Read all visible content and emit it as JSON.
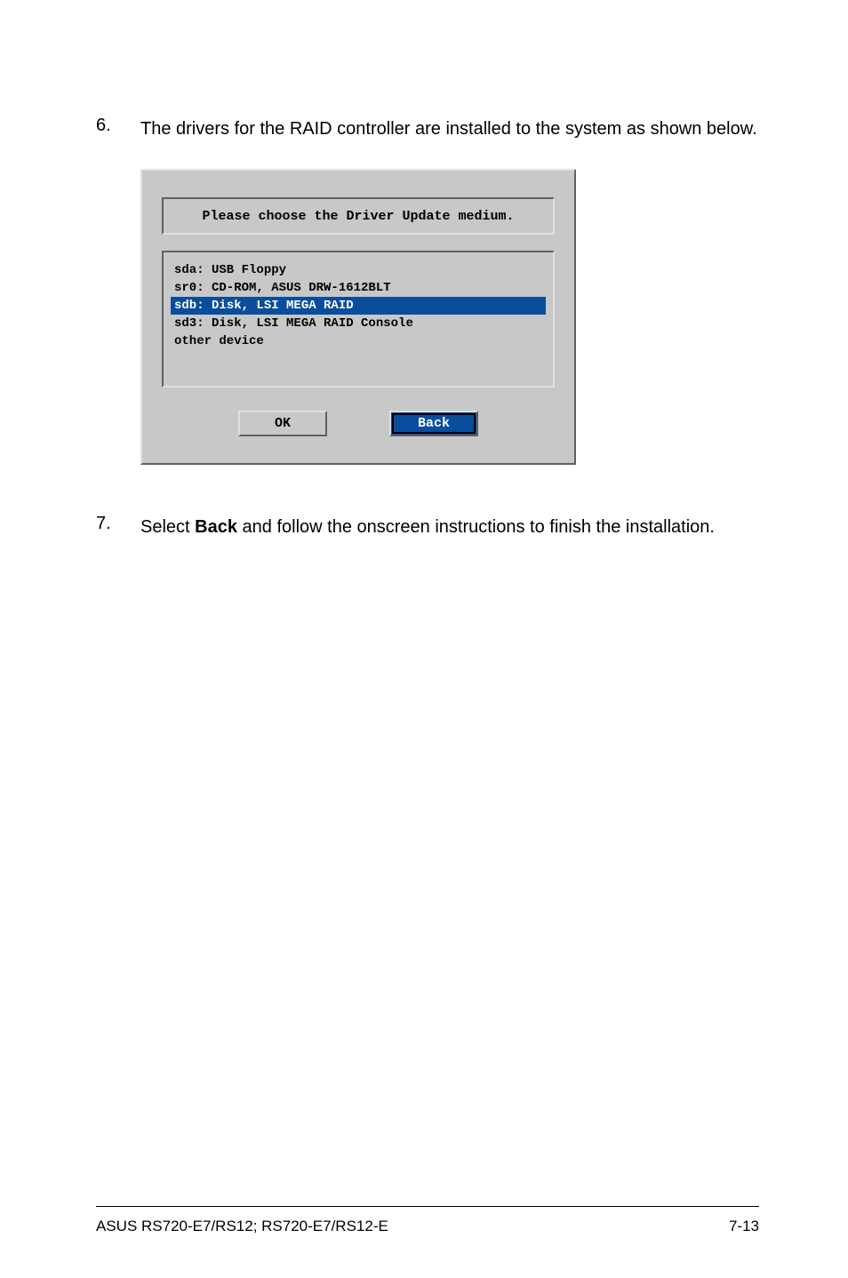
{
  "steps": {
    "6": {
      "num": "6.",
      "text": "The drivers for the RAID controller are installed to the system as shown below."
    },
    "7": {
      "num": "7.",
      "text_before": "Select ",
      "bold": "Back",
      "text_after": " and follow the onscreen instructions to finish the installation."
    }
  },
  "dialog": {
    "title": "Please choose the Driver Update medium.",
    "items": [
      "sda: USB Floppy",
      "sr0: CD-ROM, ASUS DRW-1612BLT",
      "sdb: Disk, LSI MEGA RAID",
      "sd3: Disk, LSI MEGA RAID Console",
      "other device"
    ],
    "selected_index": 2,
    "buttons": {
      "ok": "OK",
      "back": "Back"
    }
  },
  "footer": {
    "left": "ASUS RS720-E7/RS12; RS720-E7/RS12-E",
    "right": "7-13"
  }
}
